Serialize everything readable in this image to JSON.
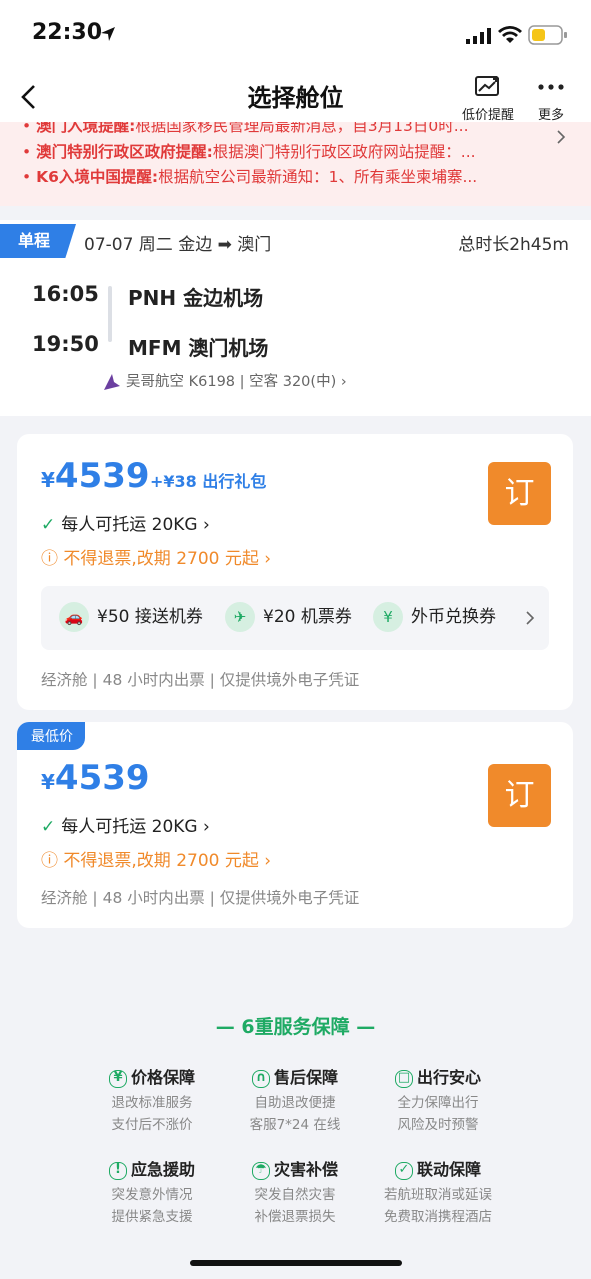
{
  "status": {
    "time": "22:30"
  },
  "nav": {
    "title": "选择舱位",
    "price_alert": "低价提醒",
    "more": "更多"
  },
  "alerts": [
    {
      "label": "澳门入境提醒:",
      "text": "根据国家移民管理局最新消息，自3月13日0时..."
    },
    {
      "label": "澳门特别行政区政府提醒:",
      "text": "根据澳门特别行政区政府网站提醒：..."
    },
    {
      "label": "K6入境中国提醒:",
      "text": "根据航空公司最新通知：1、所有乘坐柬埔寨..."
    }
  ],
  "trip": {
    "tag": "单程",
    "route": "07-07 周二 金边 ➡ 澳门",
    "duration": "总时长2h45m",
    "depart_time": "16:05",
    "depart_airport": "PNH 金边机场",
    "arrive_time": "19:50",
    "arrive_airport": "MFM 澳门机场",
    "airline": "吴哥航空 K6198 | 空客 320(中) ›"
  },
  "fares": [
    {
      "currency": "¥",
      "price": "4539",
      "gift": "+¥38 出行礼包",
      "book": "订",
      "baggage": "每人可托运 20KG ›",
      "refund": "ⓘ 不得退票,改期 2700 元起 ›",
      "perks": [
        {
          "icon": "car-icon",
          "glyph": "🚗",
          "label": "¥50 接送机券"
        },
        {
          "icon": "plane-icon",
          "glyph": "✈",
          "label": "¥20 机票券"
        },
        {
          "icon": "exchange-icon",
          "glyph": "¥",
          "label": "外币兑换券"
        }
      ],
      "footer": "经济舱 | 48 小时内出票 | 仅提供境外电子凭证"
    },
    {
      "tag": "最低价",
      "currency": "¥",
      "price": "4539",
      "book": "订",
      "baggage": "每人可托运 20KG ›",
      "refund": "ⓘ 不得退票,改期 2700 元起 ›",
      "footer": "经济舱 | 48 小时内出票 | 仅提供境外电子凭证"
    }
  ],
  "guarantee": {
    "title": "— 6重服务保障 —",
    "items": [
      {
        "icon": "yuan-icon",
        "glyph": "¥",
        "title": "价格保障",
        "line1": "退改标准服务",
        "line2": "支付后不涨价"
      },
      {
        "icon": "headset-icon",
        "glyph": "∩",
        "title": "售后保障",
        "line1": "自助退改便捷",
        "line2": "客服7*24 在线"
      },
      {
        "icon": "briefcase-icon",
        "glyph": "□",
        "title": "出行安心",
        "line1": "全力保障出行",
        "line2": "风险及时预警"
      },
      {
        "icon": "alarm-icon",
        "glyph": "!",
        "title": "应急援助",
        "line1": "突发意外情况",
        "line2": "提供紧急支援"
      },
      {
        "icon": "umbrella-icon",
        "glyph": "☂",
        "title": "灾害补偿",
        "line1": "突发自然灾害",
        "line2": "补偿退票损失"
      },
      {
        "icon": "shield-icon",
        "glyph": "✓",
        "title": "联动保障",
        "line1": "若航班取消或延误",
        "line2": "免费取消携程酒店"
      }
    ]
  },
  "colors": {
    "accent": "#2f7fe6",
    "book": "#f08a2b",
    "green": "#1faa64",
    "alert": "#e03a3a"
  }
}
